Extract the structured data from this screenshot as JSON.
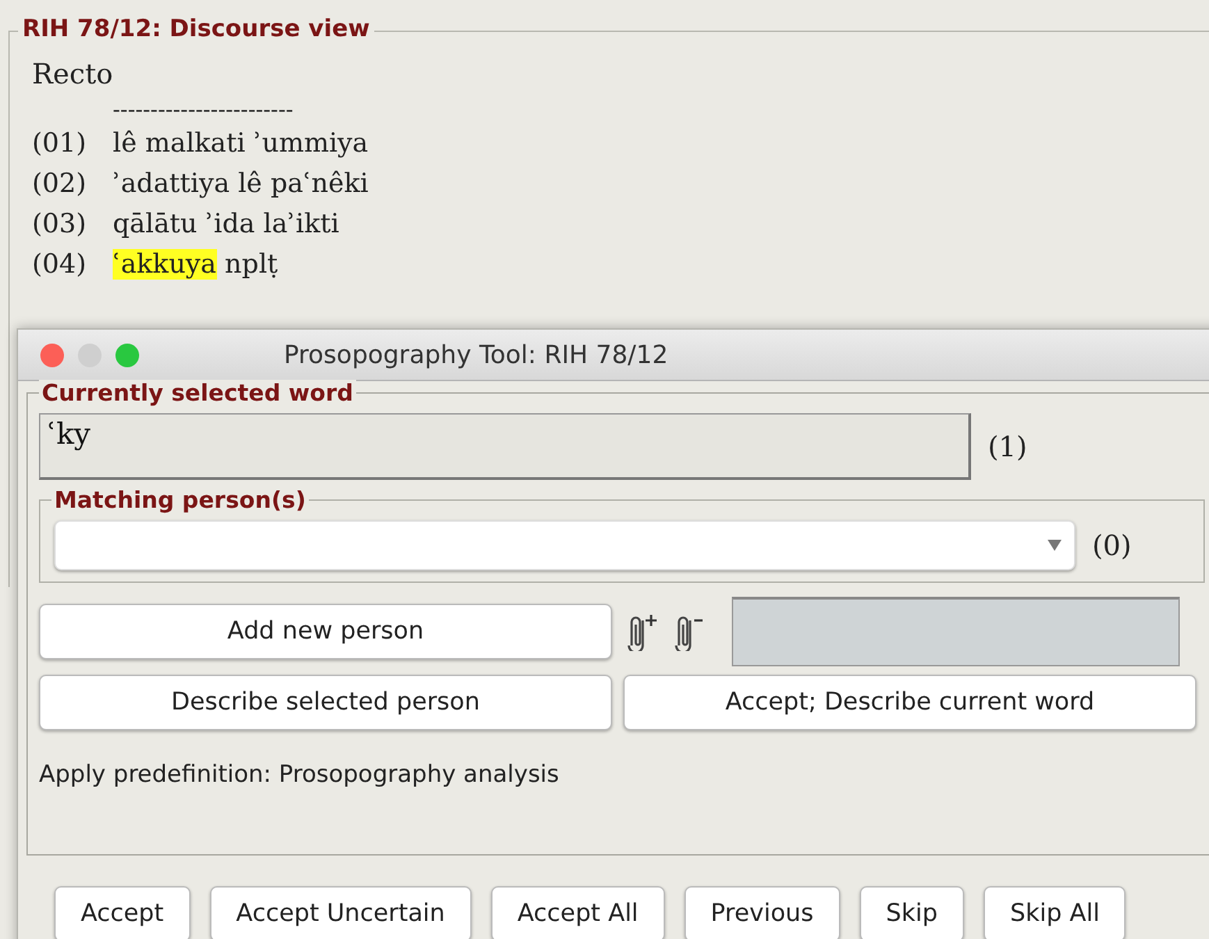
{
  "discourse_view": {
    "title": "RIH 78/12: Discourse view",
    "section": "Recto",
    "separator": "------------------------",
    "lines": [
      {
        "number": "(01)",
        "segments": [
          {
            "text": "lê malkati ʾummiya",
            "highlighted": false
          }
        ]
      },
      {
        "number": "(02)",
        "segments": [
          {
            "text": "ʾadattiya lê paʿnêki",
            "highlighted": false
          }
        ]
      },
      {
        "number": "(03)",
        "segments": [
          {
            "text": "qālātu ʾida laʾikti",
            "highlighted": false
          }
        ]
      },
      {
        "number": "(04)",
        "segments": [
          {
            "text": "ʿakkuya",
            "highlighted": true
          },
          {
            "text": " nplṭ",
            "highlighted": false
          }
        ]
      }
    ]
  },
  "dialog": {
    "title": "Prosopography Tool: RIH 78/12",
    "selected_word": {
      "legend": "Currently selected word",
      "value": "ʿky",
      "count": "(1)"
    },
    "matching": {
      "legend": "Matching person(s)",
      "count": "(0)"
    },
    "add_button": "Add new person",
    "describe_button": "Describe selected person",
    "accept_describe_button": "Accept; Describe current word",
    "predefinition": "Apply predefinition: Prosopography analysis",
    "buttons": [
      "Accept",
      "Accept Uncertain",
      "Accept All",
      "Previous",
      "Skip",
      "Skip All"
    ]
  }
}
